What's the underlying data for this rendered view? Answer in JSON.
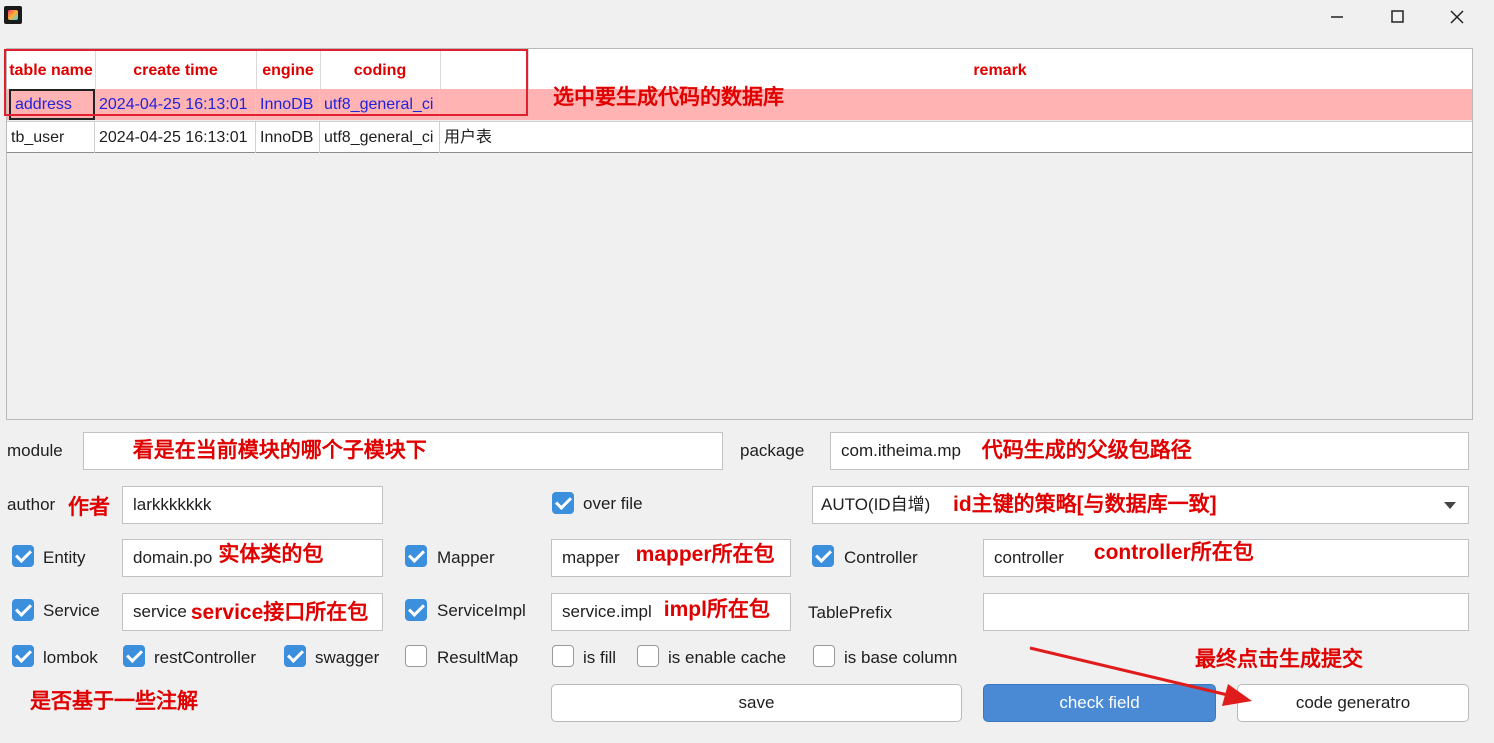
{
  "window": {
    "controls": [
      "minimize-icon",
      "maximize-icon",
      "close-icon"
    ]
  },
  "table": {
    "headers": [
      "table name",
      "create time",
      "engine",
      "coding",
      "",
      "remark"
    ],
    "rows": [
      [
        "address",
        "2024-04-25 16:13:01",
        "InnoDB",
        "utf8_general_ci",
        ""
      ],
      [
        "tb_user",
        "2024-04-25 16:13:01",
        "InnoDB",
        "utf8_general_ci",
        "用户表"
      ]
    ]
  },
  "annotations": {
    "select_db": "选中要生成代码的数据库",
    "module_hint": "看是在当前模块的哪个子模块下",
    "package_hint": "代码生成的父级包路径",
    "author_hint": "作者",
    "idtype_hint": "id主键的策略[与数据库一致]",
    "entity_hint": "实体类的包",
    "mapper_hint": "mapper所在包",
    "controller_hint": "controller所在包",
    "service_hint": "service接口所在包",
    "impl_hint": "impl所在包",
    "annotation_hint": "是否基于一些注解",
    "submit_hint": "最终点击生成提交"
  },
  "form": {
    "module_label": "module",
    "module_value": "",
    "package_label": "package",
    "package_value": "com.itheima.mp",
    "author_label": "author",
    "author_value": "larkkkkkkk",
    "over_file_label": "over file",
    "over_file_checked": true,
    "id_type_value": "AUTO(ID自增)",
    "entity_label": "Entity",
    "entity_value": "domain.po",
    "mapper_label": "Mapper",
    "mapper_value": "mapper",
    "controller_label": "Controller",
    "controller_value": "controller",
    "service_label": "Service",
    "service_value": "service",
    "serviceimpl_label": "ServiceImpl",
    "serviceimpl_value": "service.impl",
    "tableprefix_label": "TablePrefix",
    "tableprefix_value": ""
  },
  "options": [
    {
      "label": "lombok",
      "checked": true
    },
    {
      "label": "restController",
      "checked": true
    },
    {
      "label": "swagger",
      "checked": true
    },
    {
      "label": "ResultMap",
      "checked": false
    },
    {
      "label": "is fill",
      "checked": false
    },
    {
      "label": "is enable cache",
      "checked": false
    },
    {
      "label": "is base column",
      "checked": false
    }
  ],
  "buttons": {
    "save": "save",
    "check_field": "check field",
    "code_generator": "code generatro"
  },
  "colors": {
    "annotation": "#e00000",
    "accent": "#3c8fdc",
    "selected_row": "#ffb3b3"
  }
}
